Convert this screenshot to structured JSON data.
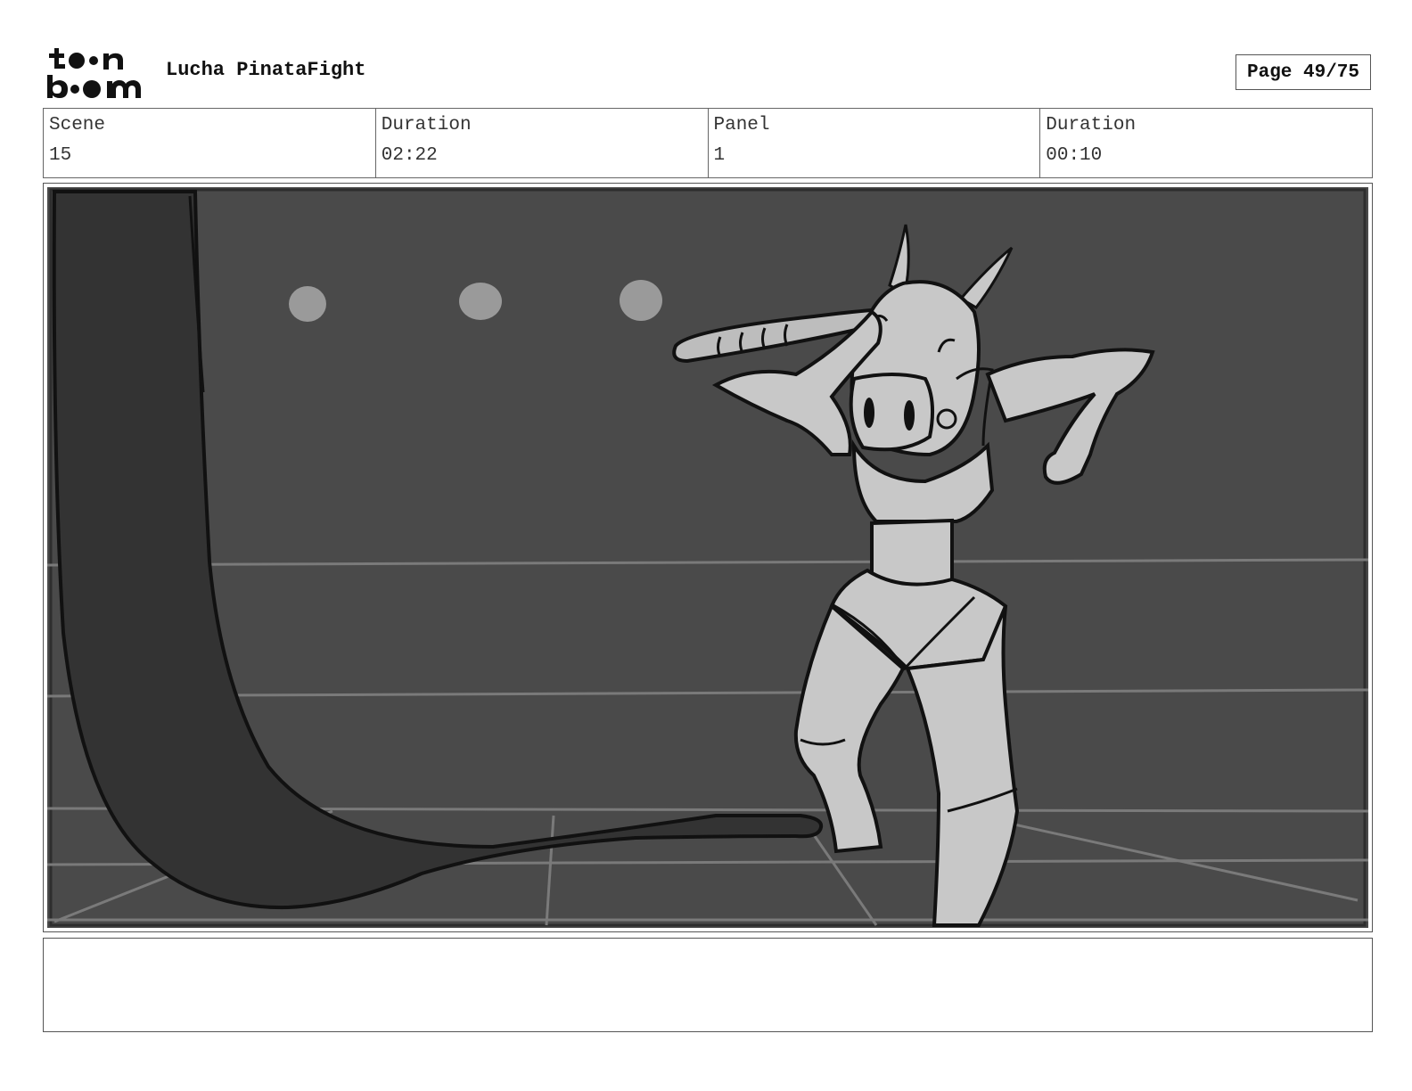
{
  "header": {
    "logo_text": "toonboom",
    "project_title": "Lucha PinataFight",
    "page_counter": "Page 49/75"
  },
  "info": {
    "scene_label": "Scene",
    "scene_value": "15",
    "scene_duration_label": "Duration",
    "scene_duration_value": "02:22",
    "panel_label": "Panel",
    "panel_value": "1",
    "panel_duration_label": "Duration",
    "panel_duration_value": "00:10"
  },
  "notes": {
    "text": ""
  }
}
